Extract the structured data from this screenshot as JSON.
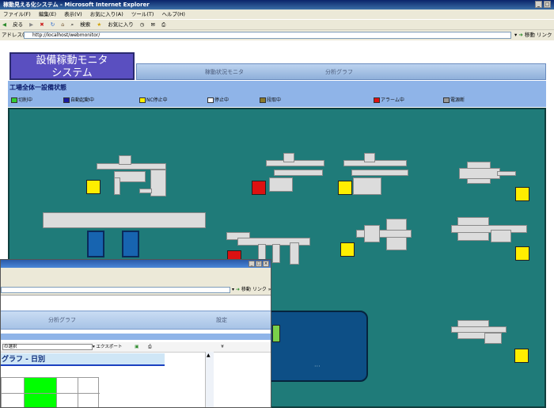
{
  "browser": {
    "title": "稼動見える化システム - Microsoft Internet Explorer",
    "menu": [
      "ファイル(F)",
      "編集(E)",
      "表示(V)",
      "お気に入り(A)",
      "ツール(T)",
      "ヘルプ(H)"
    ],
    "toolbar": [
      "戻る",
      "検索",
      "お気に入り"
    ],
    "address_label": "アドレス(D)",
    "address_url": "http://localhost/webmonitor/",
    "go_label": "移動",
    "links_label": "リンク"
  },
  "app": {
    "logo_line1": "設備稼動モニタ",
    "logo_line2": "システム",
    "nav": [
      "稼動状況モニタ",
      "分析グラフ"
    ],
    "section_title": "工場全体一設備状態",
    "legend": [
      {
        "label": "切削中",
        "color": "#33cc33"
      },
      {
        "label": "自動起動中",
        "color": "#1a1aa0"
      },
      {
        "label": "NC停止中",
        "color": "#ffee00"
      },
      {
        "label": "停止中",
        "color": "#ffffff"
      },
      {
        "label": "段取中",
        "color": "#8a7a2a"
      },
      {
        "label": "アラーム中",
        "color": "#dd1111"
      },
      {
        "label": "電源断",
        "color": "#9a9a9a"
      }
    ]
  },
  "lamps": {
    "yellow": "#ffee00",
    "red": "#dd1111",
    "blue": "#1a6ac8",
    "green": "#7ad04a"
  },
  "overlay": {
    "go_label": "移動",
    "links_label": "リンク »",
    "nav": [
      "分析グラフ",
      "設定"
    ],
    "selector": "の選択",
    "export_label": "エクスポート",
    "graph_title": "グラフ - 日別",
    "bar_color": "#00ff00"
  }
}
